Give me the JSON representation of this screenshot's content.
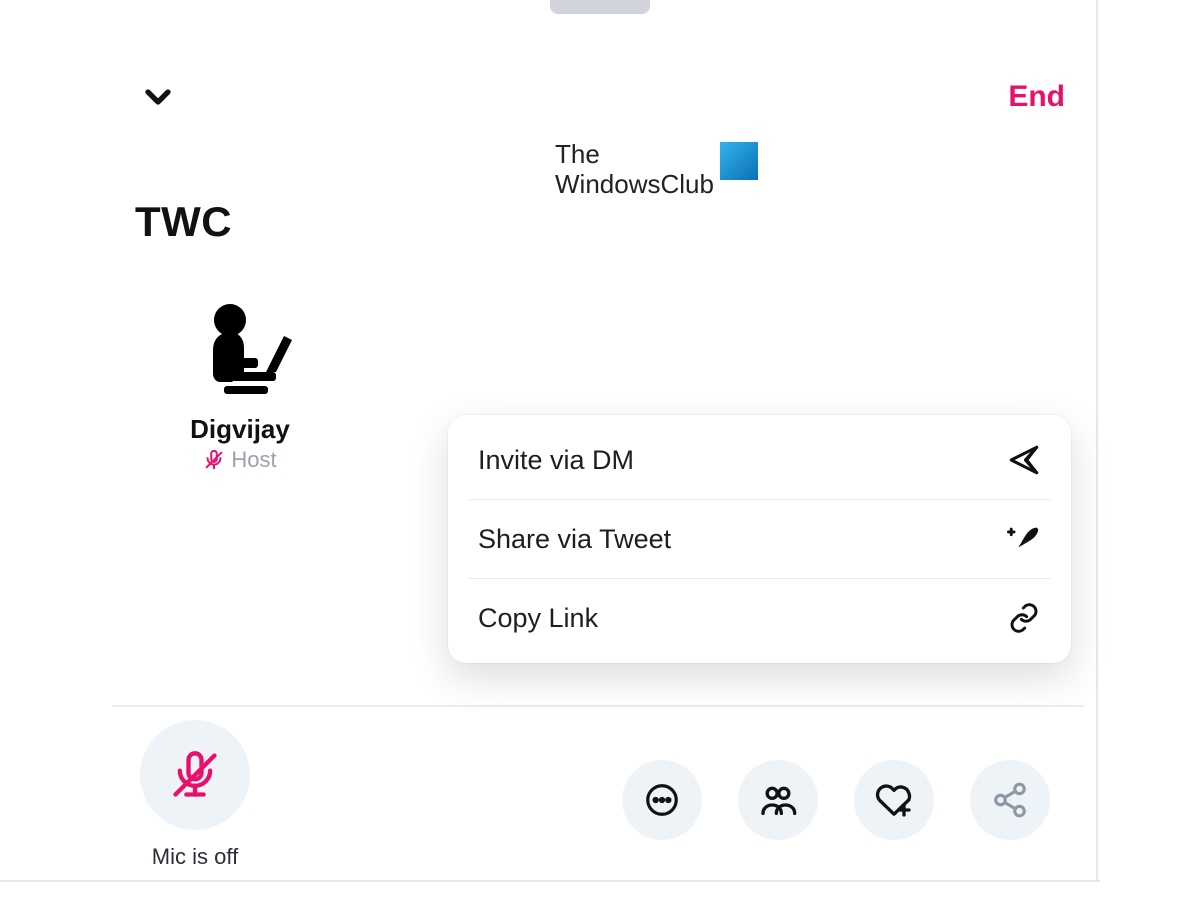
{
  "header": {
    "end_label": "End"
  },
  "branding": {
    "line1": "The",
    "line2": "WindowsClub"
  },
  "room": {
    "title": "TWC"
  },
  "participant": {
    "name": "Digvijay",
    "role": "Host"
  },
  "share_menu": {
    "items": [
      {
        "label": "Invite via DM"
      },
      {
        "label": "Share via Tweet"
      },
      {
        "label": "Copy Link"
      }
    ]
  },
  "bottom": {
    "mic_label": "Mic is off"
  },
  "colors": {
    "accent": "#e7106d"
  }
}
